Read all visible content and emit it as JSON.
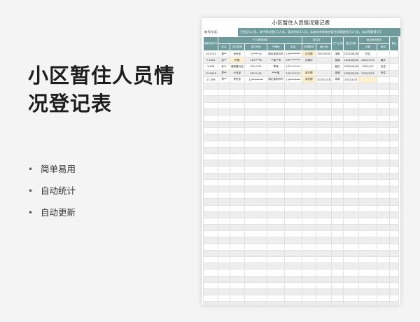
{
  "promo": {
    "title_line1": "小区暂住人员情",
    "title_line2": "况登记表",
    "bullets": [
      "简单易用",
      "自动统计",
      "自动更新"
    ],
    "bullet_dot": "•"
  },
  "sheet": {
    "title": "小区暂住人员情况登记表",
    "building_label": "栋号/小区：",
    "note": "已登记1人员。其中到访登记1人员。暂未到访1人员。本地非李常夜护暂住再随遇登记1人员。本次随意登记2",
    "group_headers": {
      "personal": "个人基本信息",
      "reg_status": "暂住证",
      "household": "与户主关系",
      "checkin": "登记日期",
      "latest": "最近回访情况",
      "remark": "备注"
    },
    "col_headers": {
      "room": "楼栋及房号",
      "name": "姓名",
      "id_type": "证件类型",
      "id_no": "证件号码",
      "hukou": "户籍地",
      "phone": "电话",
      "handle": "办理情况",
      "expire": "截止期",
      "date": "日期",
      "status": "情况"
    },
    "rows": [
      [
        "14-1101",
        "费**",
        "身份证",
        "11****10",
        "湖北省武汉市",
        "13*********",
        "已办理",
        "2023/5/30",
        "未租",
        "2022/06/30",
        "在住",
        ""
      ],
      [
        "7-2201",
        "张**",
        "护照",
        "110****8",
        "**省**市",
        "13*********",
        "办理中",
        "",
        "亲戚",
        "2022/08/02",
        "2022/1/15",
        "离开"
      ],
      [
        "3-906",
        "孙**",
        "港澳通行证",
        "33****25",
        "青海",
        "13*********",
        "",
        "",
        "租住",
        "2022/05/02",
        "2022/2/7",
        "在住"
      ],
      [
        "12-1003",
        "李**",
        "士兵证",
        "33****15",
        "****省",
        "13*********",
        "未办理",
        "",
        "亲戚",
        "2022/05/09",
        "2022/1/22",
        "在住"
      ],
      [
        "17-306",
        "郑**",
        "身份证",
        "13*********",
        "湖北省荆州市",
        "13*********",
        "未办理",
        "2023/12/30",
        "亲戚",
        "2022/1/31",
        "",
        ""
      ]
    ],
    "highlights": [
      [
        1,
        2
      ],
      [
        0,
        6
      ],
      [
        3,
        6
      ],
      [
        4,
        6
      ],
      [
        4,
        10
      ]
    ],
    "total_rows": 40
  }
}
